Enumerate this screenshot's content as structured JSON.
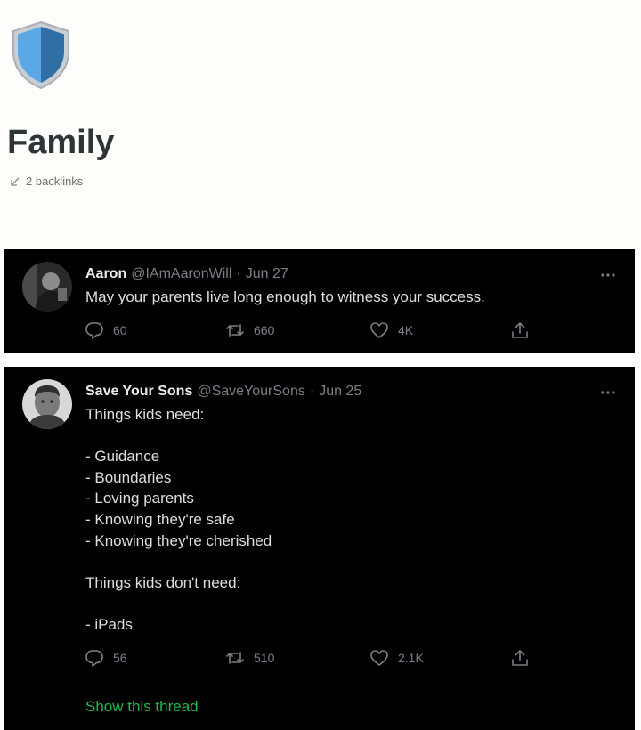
{
  "page": {
    "title": "Family",
    "icon": "shield-icon",
    "backlinks_label": "2 backlinks"
  },
  "colors": {
    "page_background": "#fdfdfb",
    "tweet_background": "#000000",
    "thread_link": "#1fb950",
    "shield_light": "#5aa9e6",
    "shield_dark": "#2f6fa3"
  },
  "tweets": [
    {
      "author_name": "Aaron",
      "author_handle": "@IAmAaronWill",
      "separator": "·",
      "date": "Jun 27",
      "text": "May your parents live long enough to witness your success.",
      "replies": "60",
      "retweets": "660",
      "likes": "4K"
    },
    {
      "author_name": "Save Your Sons",
      "author_handle": "@SaveYourSons",
      "separator": "·",
      "date": "Jun 25",
      "text": "Things kids need:\n\n- Guidance\n- Boundaries\n- Loving parents\n- Knowing they're safe\n- Knowing they're cherished\n\nThings kids don't need:\n\n- iPads",
      "replies": "56",
      "retweets": "510",
      "likes": "2.1K",
      "thread_link": "Show this thread"
    }
  ]
}
